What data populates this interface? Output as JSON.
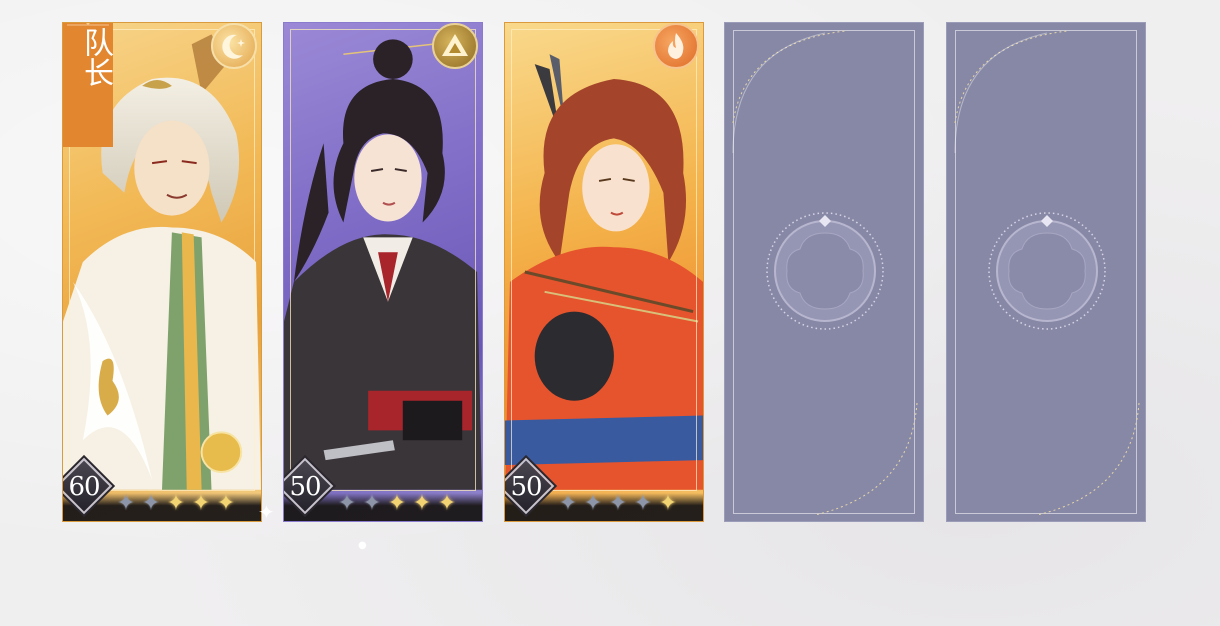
{
  "team": {
    "captain_label": "队长",
    "slots": [
      {
        "character": "white-haired-noble",
        "element": "moon",
        "level": "60",
        "stars_lit": 3,
        "stars_total": 5
      },
      {
        "character": "dark-haired-swordsman",
        "element": "triangle",
        "level": "50",
        "stars_lit": 3,
        "stars_total": 5
      },
      {
        "character": "red-haired-archer",
        "element": "fire",
        "level": "50",
        "stars_lit": 1,
        "stars_total": 5
      },
      {
        "empty": true
      },
      {
        "empty": true
      }
    ]
  },
  "colors": {
    "gold_card": "#f2b956",
    "purple_card": "#7d6bc6",
    "orange_card": "#ee8f2f",
    "empty_slot": "#8788a6",
    "captain_banner": "#e2862f",
    "star_lit": "#f3d472",
    "star_dim": "#8d95a8"
  }
}
